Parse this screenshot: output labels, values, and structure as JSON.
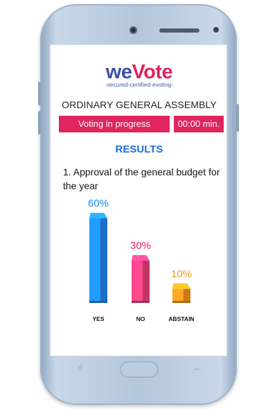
{
  "logo": {
    "we": "we",
    "vote": "Vote",
    "tagline": "-secured-certified-evoting-"
  },
  "assembly_title": "ORDINARY GENERAL ASSEMBLY",
  "status": {
    "label": "Voting in progress",
    "timer": "00:00 min."
  },
  "results_heading": "RESULTS",
  "question": "1. Approval of the general budget for the year",
  "chart_data": {
    "type": "bar",
    "categories": [
      "YES",
      "NO",
      "ABSTAIN"
    ],
    "values": [
      60,
      30,
      10
    ],
    "value_labels": [
      "60%",
      "30%",
      "10%"
    ],
    "ylim": [
      0,
      60
    ],
    "colors": [
      "#1e88f0",
      "#ec3f7b",
      "#f7931e"
    ],
    "label_colors": [
      "#1e88f0",
      "#e0245e",
      "#f7931e"
    ]
  },
  "icons": {
    "recent": "recent-apps-icon",
    "back": "back-arrow-icon"
  },
  "colors": {
    "brand_blue": "#3a4ea8",
    "brand_pink": "#e0245e",
    "accent_blue": "#1e6fd9"
  }
}
